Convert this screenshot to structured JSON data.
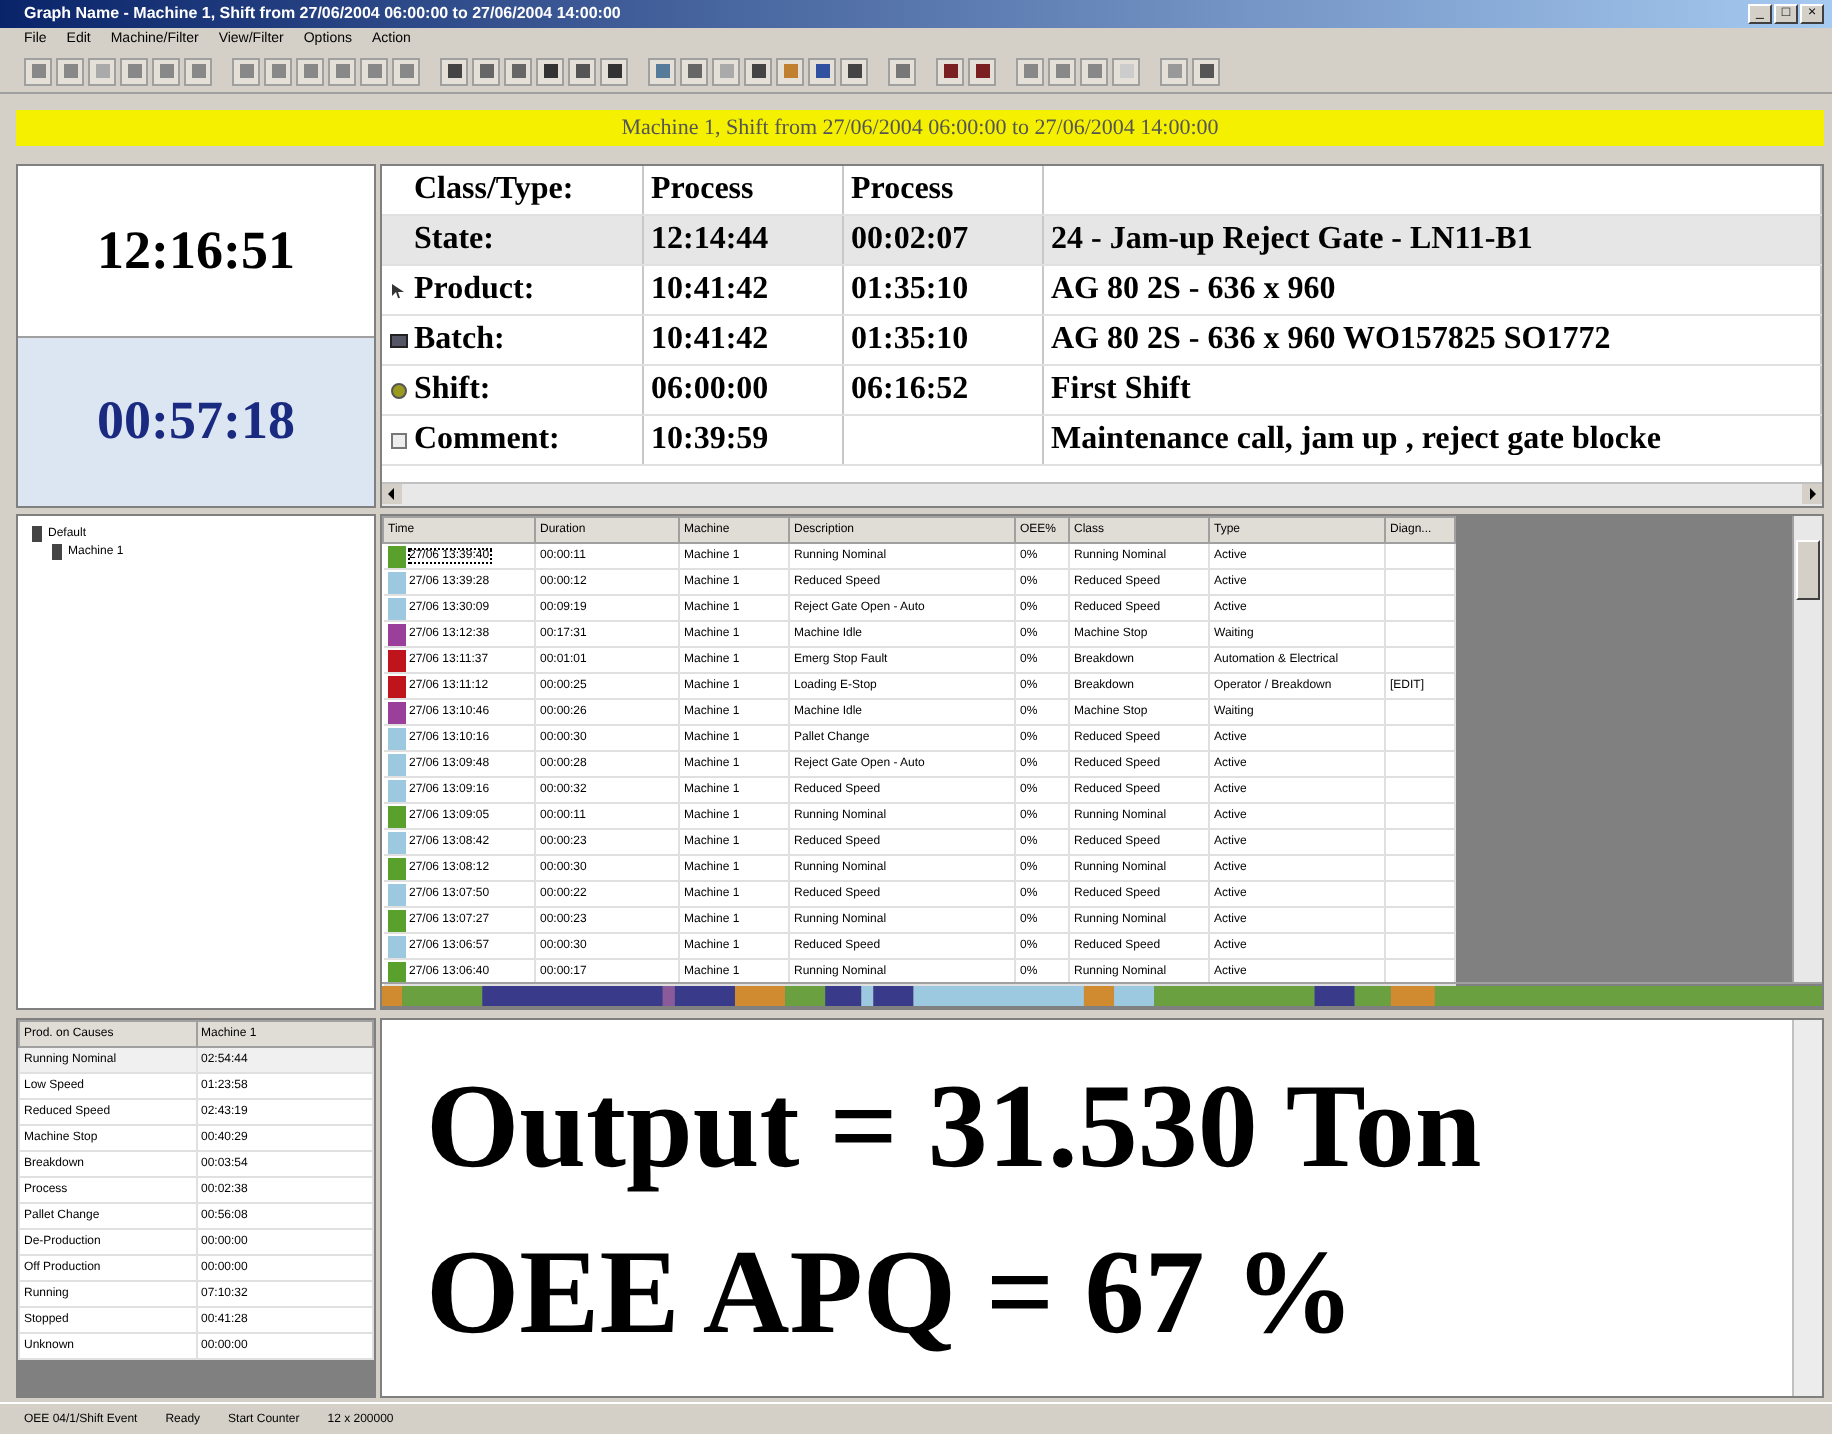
{
  "window": {
    "title": "Graph Name - Machine 1, Shift from 27/06/2004 06:00:00 to 27/06/2004 14:00:00",
    "controls": [
      "_",
      "□",
      "×"
    ]
  },
  "menu": [
    "File",
    "Edit",
    "Machine/Filter",
    "View/Filter",
    "Options",
    "Action"
  ],
  "banner": "Machine 1, Shift from 27/06/2004 06:00:00 to 27/06/2004 14:00:00",
  "clock": {
    "time": "12:16:51",
    "elapsed": "00:57:18"
  },
  "info": {
    "rows": [
      {
        "kind": "header",
        "label": "Class/Type:",
        "value_1": "Process",
        "value_2": "Process",
        "text": "",
        "selected": false
      },
      {
        "kind": "none",
        "label": "State:",
        "value_1": "12:14:44",
        "value_2": "00:02:07",
        "text": "24 - Jam-up Reject Gate - LN11-B1",
        "selected": true
      },
      {
        "kind": "pointer",
        "label": "Product:",
        "value_1": "10:41:42",
        "value_2": "01:35:10",
        "text": "AG 80 2S - 636 x 960",
        "selected": false
      },
      {
        "kind": "batch",
        "label": "Batch:",
        "value_1": "10:41:42",
        "value_2": "01:35:10",
        "text": "AG 80 2S - 636 x 960 WO157825 SO1772",
        "selected": false
      },
      {
        "kind": "shift",
        "label": "Shift:",
        "value_1": "06:00:00",
        "value_2": "06:16:52",
        "text": "First Shift",
        "selected": false
      },
      {
        "kind": "comment",
        "label": "Comment:",
        "value_1": "10:39:59",
        "value_2": "",
        "text": "Maintenance call, jam up , reject gate blocke",
        "selected": false
      }
    ]
  },
  "tree": [
    {
      "label": "Default",
      "children": [
        {
          "label": "Machine 1"
        }
      ]
    }
  ],
  "events": {
    "columns": [
      "Time",
      "Duration",
      "Machine",
      "Description",
      "OEE%",
      "Class",
      "Type",
      "Diagn..."
    ],
    "rows": [
      {
        "color": "#5aa02c",
        "selected": true,
        "cells": [
          "27/06 13:39:40",
          "00:00:11",
          "Machine 1",
          "Running Nominal",
          "0%",
          "Running Nominal",
          "Active",
          ""
        ]
      },
      {
        "color": "#9cc8e0",
        "selected": false,
        "cells": [
          "27/06 13:39:28",
          "00:00:12",
          "Machine 1",
          "Reduced Speed",
          "0%",
          "Reduced Speed",
          "Active",
          ""
        ]
      },
      {
        "color": "#9cc8e0",
        "selected": false,
        "cells": [
          "27/06 13:30:09",
          "00:09:19",
          "Machine 1",
          "Reject Gate Open - Auto",
          "0%",
          "Reduced Speed",
          "Active",
          ""
        ]
      },
      {
        "color": "#9a3f9a",
        "selected": false,
        "cells": [
          "27/06 13:12:38",
          "00:17:31",
          "Machine 1",
          "Machine Idle",
          "0%",
          "Machine Stop",
          "Waiting",
          ""
        ]
      },
      {
        "color": "#c0141c",
        "selected": false,
        "cells": [
          "27/06 13:11:37",
          "00:01:01",
          "Machine 1",
          "Emerg Stop Fault",
          "0%",
          "Breakdown",
          "Automation & Electrical",
          ""
        ]
      },
      {
        "color": "#c0141c",
        "selected": false,
        "cells": [
          "27/06 13:11:12",
          "00:00:25",
          "Machine 1",
          "Loading E-Stop",
          "0%",
          "Breakdown",
          "Operator / Breakdown",
          "[EDIT]"
        ]
      },
      {
        "color": "#9a3f9a",
        "selected": false,
        "cells": [
          "27/06 13:10:46",
          "00:00:26",
          "Machine 1",
          "Machine Idle",
          "0%",
          "Machine Stop",
          "Waiting",
          ""
        ]
      },
      {
        "color": "#9cc8e0",
        "selected": false,
        "cells": [
          "27/06 13:10:16",
          "00:00:30",
          "Machine 1",
          "Pallet Change",
          "0%",
          "Reduced Speed",
          "Active",
          ""
        ]
      },
      {
        "color": "#9cc8e0",
        "selected": false,
        "cells": [
          "27/06 13:09:48",
          "00:00:28",
          "Machine 1",
          "Reject Gate Open - Auto",
          "0%",
          "Reduced Speed",
          "Active",
          ""
        ]
      },
      {
        "color": "#9cc8e0",
        "selected": false,
        "cells": [
          "27/06 13:09:16",
          "00:00:32",
          "Machine 1",
          "Reduced Speed",
          "0%",
          "Reduced Speed",
          "Active",
          ""
        ]
      },
      {
        "color": "#5aa02c",
        "selected": false,
        "cells": [
          "27/06 13:09:05",
          "00:00:11",
          "Machine 1",
          "Running Nominal",
          "0%",
          "Running Nominal",
          "Active",
          ""
        ]
      },
      {
        "color": "#9cc8e0",
        "selected": false,
        "cells": [
          "27/06 13:08:42",
          "00:00:23",
          "Machine 1",
          "Reduced Speed",
          "0%",
          "Reduced Speed",
          "Active",
          ""
        ]
      },
      {
        "color": "#5aa02c",
        "selected": false,
        "cells": [
          "27/06 13:08:12",
          "00:00:30",
          "Machine 1",
          "Running Nominal",
          "0%",
          "Running Nominal",
          "Active",
          ""
        ]
      },
      {
        "color": "#9cc8e0",
        "selected": false,
        "cells": [
          "27/06 13:07:50",
          "00:00:22",
          "Machine 1",
          "Reduced Speed",
          "0%",
          "Reduced Speed",
          "Active",
          ""
        ]
      },
      {
        "color": "#5aa02c",
        "selected": false,
        "cells": [
          "27/06 13:07:27",
          "00:00:23",
          "Machine 1",
          "Running Nominal",
          "0%",
          "Running Nominal",
          "Active",
          ""
        ]
      },
      {
        "color": "#9cc8e0",
        "selected": false,
        "cells": [
          "27/06 13:06:57",
          "00:00:30",
          "Machine 1",
          "Reduced Speed",
          "0%",
          "Reduced Speed",
          "Active",
          ""
        ]
      },
      {
        "color": "#5aa02c",
        "selected": false,
        "cells": [
          "27/06 13:06:40",
          "00:00:17",
          "Machine 1",
          "Running Nominal",
          "0%",
          "Running Nominal",
          "Active",
          ""
        ]
      }
    ]
  },
  "summary": {
    "columns": [
      "Prod. on Causes",
      "Machine 1"
    ],
    "rows": [
      [
        "Running Nominal",
        "02:54:44"
      ],
      [
        "Low Speed",
        "01:23:58"
      ],
      [
        "Reduced Speed",
        "02:43:19"
      ],
      [
        "Machine Stop",
        "00:40:29"
      ],
      [
        "Breakdown",
        "00:03:54"
      ],
      [
        "Process",
        "00:02:38"
      ],
      [
        "Pallet Change",
        "00:56:08"
      ],
      [
        "De-Production",
        "00:00:00"
      ],
      [
        "Off Production",
        "00:00:00"
      ],
      [
        "Running",
        "07:10:32"
      ],
      [
        "Stopped",
        "00:41:28"
      ],
      [
        "Unknown",
        "00:00:00"
      ]
    ]
  },
  "output": [
    "Output = 31.530 Ton",
    "OEE APQ = 67 %"
  ],
  "status_bar": [
    "OEE 04/1/Shift Event",
    "Ready",
    "Start Counter",
    "12 x 200000"
  ]
}
